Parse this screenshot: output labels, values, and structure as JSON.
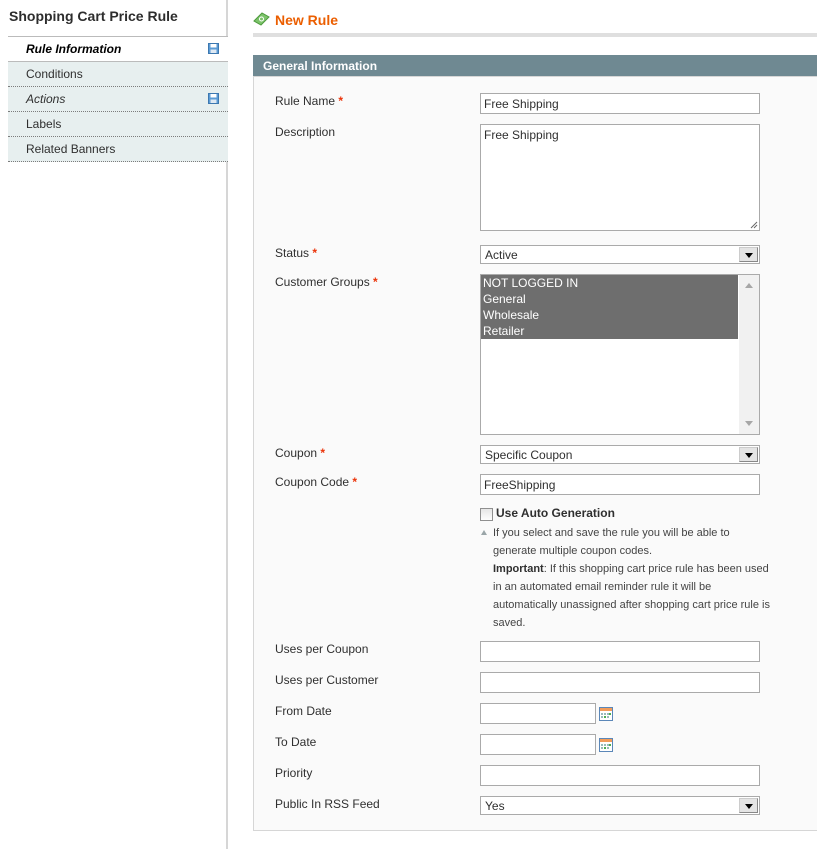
{
  "sidebar": {
    "title": "Shopping Cart Price Rule",
    "tabs": [
      {
        "label": "Rule Information",
        "active": true,
        "changed": true
      },
      {
        "label": "Conditions",
        "active": false,
        "changed": false
      },
      {
        "label": "Actions",
        "active": false,
        "changed": true
      },
      {
        "label": "Labels",
        "active": false,
        "changed": false
      },
      {
        "label": "Related Banners",
        "active": false,
        "changed": false
      }
    ]
  },
  "header": {
    "title": "New Rule",
    "icon": "rule-money-icon",
    "title_color": "#eb5e00"
  },
  "fieldset": {
    "title": "General Information",
    "header_color": "#6f8992",
    "fields": {
      "rule_name": {
        "label": "Rule Name",
        "required": "*",
        "value": "Free Shipping"
      },
      "description": {
        "label": "Description",
        "value": "Free Shipping"
      },
      "status": {
        "label": "Status",
        "required": "*",
        "value": "Active"
      },
      "customer_groups": {
        "label": "Customer Groups",
        "required": "*",
        "options": [
          "NOT LOGGED IN",
          "General",
          "Wholesale",
          "Retailer"
        ],
        "selected": [
          "NOT LOGGED IN",
          "General",
          "Wholesale",
          "Retailer"
        ]
      },
      "coupon": {
        "label": "Coupon",
        "required": "*",
        "value": "Specific Coupon"
      },
      "coupon_code": {
        "label": "Coupon Code",
        "required": "*",
        "value": "FreeShipping"
      },
      "auto_generation": {
        "label": "Use Auto Generation",
        "checked": false,
        "note_line1": "If you select and save the rule you will be able to generate multiple coupon codes.",
        "note_important": "Important",
        "note_line2": ": If this shopping cart price rule has been used in an automated email reminder rule it will be automatically unassigned after shopping cart price rule is saved."
      },
      "uses_per_coupon": {
        "label": "Uses per Coupon",
        "value": ""
      },
      "uses_per_customer": {
        "label": "Uses per Customer",
        "value": ""
      },
      "from_date": {
        "label": "From Date",
        "value": ""
      },
      "to_date": {
        "label": "To Date",
        "value": ""
      },
      "priority": {
        "label": "Priority",
        "value": ""
      },
      "public_in_rss": {
        "label": "Public In RSS Feed",
        "value": "Yes"
      }
    }
  },
  "colors": {
    "required": "#eb340a",
    "selected_option_bg": "#6e6e6e",
    "tab_bg": "#e7efef"
  }
}
